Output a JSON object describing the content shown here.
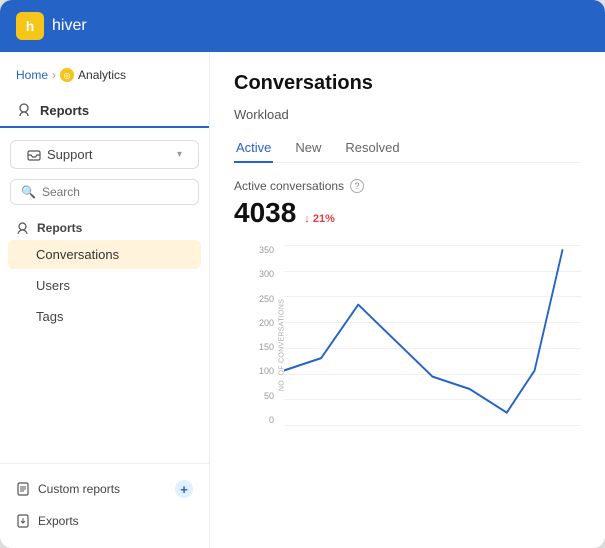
{
  "app": {
    "name": "hiver",
    "logo_letter": "h"
  },
  "breadcrumb": {
    "home": "Home",
    "separator": "›",
    "current": "Analytics"
  },
  "sidebar": {
    "main_section": "Reports",
    "dropdown_label": "Support",
    "search_placeholder": "Search",
    "sub_section": "Reports",
    "items": [
      {
        "label": "Conversations",
        "active": true
      },
      {
        "label": "Users",
        "active": false
      },
      {
        "label": "Tags",
        "active": false
      }
    ],
    "custom_reports_label": "Custom reports",
    "exports_label": "Exports"
  },
  "content": {
    "title": "Conversations",
    "section": "Workload",
    "tabs": [
      {
        "label": "Active",
        "active": true
      },
      {
        "label": "New",
        "active": false
      },
      {
        "label": "Resolved",
        "active": false
      }
    ],
    "metric": {
      "label": "Active conversations",
      "value": "4038",
      "change": "↓ 21%"
    },
    "chart": {
      "y_axis_title": "NO. OF CONVERSATIONS",
      "y_labels": [
        "350",
        "300",
        "250",
        "200",
        "150",
        "100",
        "50",
        "0"
      ]
    }
  }
}
